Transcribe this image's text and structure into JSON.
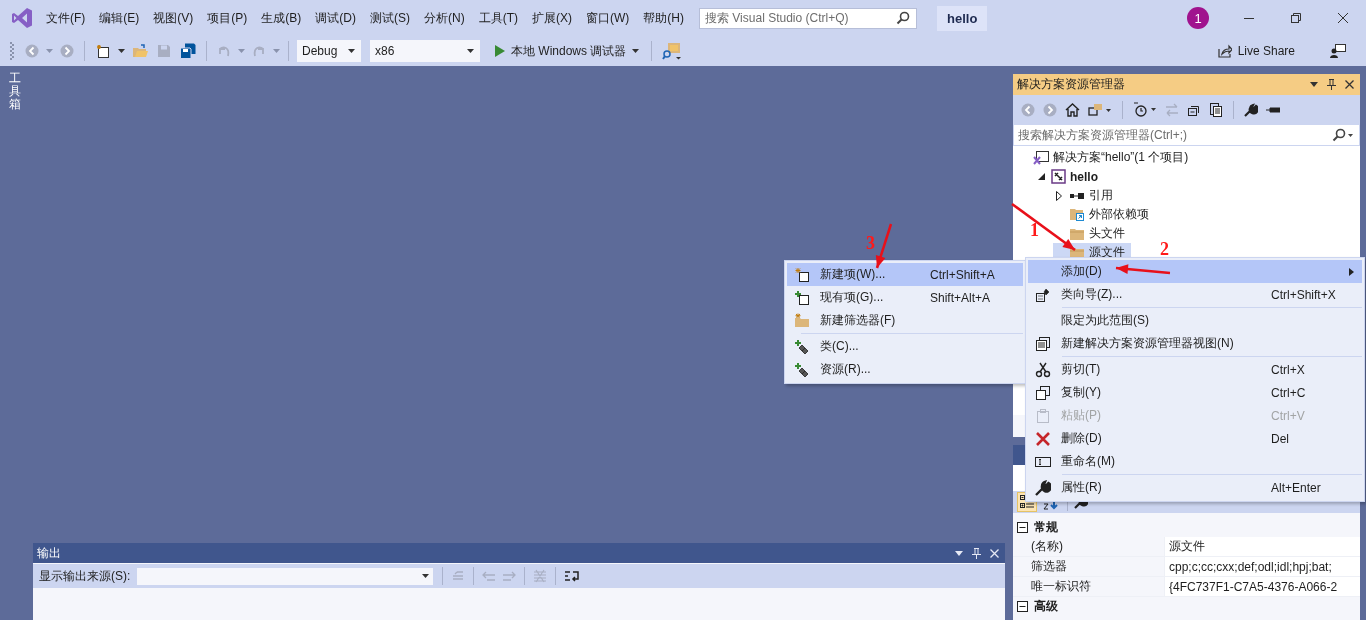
{
  "window": {
    "title": "hello",
    "notification_count": "1"
  },
  "menu": [
    "文件(F)",
    "编辑(E)",
    "视图(V)",
    "项目(P)",
    "生成(B)",
    "调试(D)",
    "测试(S)",
    "分析(N)",
    "工具(T)",
    "扩展(X)",
    "窗口(W)",
    "帮助(H)"
  ],
  "search": {
    "placeholder": "搜索 Visual Studio (Ctrl+Q)"
  },
  "toolbar": {
    "configuration": "Debug",
    "platform": "x86",
    "run_label": "本地 Windows 调试器",
    "live_share": "Live Share"
  },
  "toolbox_tab": "工具箱",
  "solution_explorer": {
    "title": "解决方案资源管理器",
    "search_placeholder": "搜索解决方案资源管理器(Ctrl+;)",
    "tree": [
      {
        "label": "解决方案“hello”(1 个项目)",
        "kind": "solution",
        "selected": false,
        "children": [
          {
            "label": "hello",
            "kind": "project",
            "expanded": true,
            "selected": false,
            "children": [
              {
                "label": "引用",
                "kind": "references",
                "expanded": false,
                "selected": false
              },
              {
                "label": "外部依赖项",
                "kind": "external",
                "selected": false
              },
              {
                "label": "头文件",
                "kind": "folder",
                "selected": false
              },
              {
                "label": "源文件",
                "kind": "folder",
                "selected": true
              }
            ]
          }
        ]
      }
    ]
  },
  "properties": {
    "sort_buttons": [
      {
        "selected": true
      },
      {
        "selected": false
      }
    ],
    "sections": [
      {
        "name": "常规",
        "expanded": true,
        "rows": [
          {
            "name": "(名称)",
            "value": "源文件"
          },
          {
            "name": "筛选器",
            "value": "cpp;c;cc;cxx;def;odl;idl;hpj;bat;"
          },
          {
            "name": "唯一标识符",
            "value": "{4FC737F1-C7A5-4376-A066-2"
          }
        ]
      },
      {
        "name": "高级",
        "expanded": true
      }
    ]
  },
  "output": {
    "title": "输出",
    "source_label": "显示输出来源(S):"
  },
  "context_menu": [
    {
      "kind": "item",
      "label": "添加(D)",
      "selected": true,
      "submenu": true
    },
    {
      "kind": "item",
      "label": "类向导(Z)...",
      "shortcut": "Ctrl+Shift+X",
      "selected": false
    },
    {
      "kind": "separator"
    },
    {
      "kind": "item",
      "label": "限定为此范围(S)",
      "selected": false
    },
    {
      "kind": "item",
      "label": "新建解决方案资源管理器视图(N)",
      "selected": false
    },
    {
      "kind": "separator"
    },
    {
      "kind": "item",
      "label": "剪切(T)",
      "shortcut": "Ctrl+X",
      "selected": false
    },
    {
      "kind": "item",
      "label": "复制(Y)",
      "shortcut": "Ctrl+C",
      "selected": false
    },
    {
      "kind": "item",
      "label": "粘贴(P)",
      "shortcut": "Ctrl+V",
      "selected": false,
      "disabled": true
    },
    {
      "kind": "item",
      "label": "删除(D)",
      "shortcut": "Del",
      "selected": false
    },
    {
      "kind": "item",
      "label": "重命名(M)",
      "selected": false
    },
    {
      "kind": "separator"
    },
    {
      "kind": "item",
      "label": "属性(R)",
      "shortcut": "Alt+Enter",
      "selected": false
    }
  ],
  "submenu": [
    {
      "kind": "item",
      "label": "新建项(W)...",
      "shortcut": "Ctrl+Shift+A",
      "selected": true
    },
    {
      "kind": "item",
      "label": "现有项(G)...",
      "shortcut": "Shift+Alt+A",
      "selected": false
    },
    {
      "kind": "item",
      "label": "新建筛选器(F)",
      "selected": false
    },
    {
      "kind": "separator"
    },
    {
      "kind": "item",
      "label": "类(C)...",
      "selected": false
    },
    {
      "kind": "item",
      "label": "资源(R)...",
      "selected": false
    }
  ],
  "annotations": [
    {
      "label": "1"
    },
    {
      "label": "2"
    },
    {
      "label": "3"
    }
  ]
}
